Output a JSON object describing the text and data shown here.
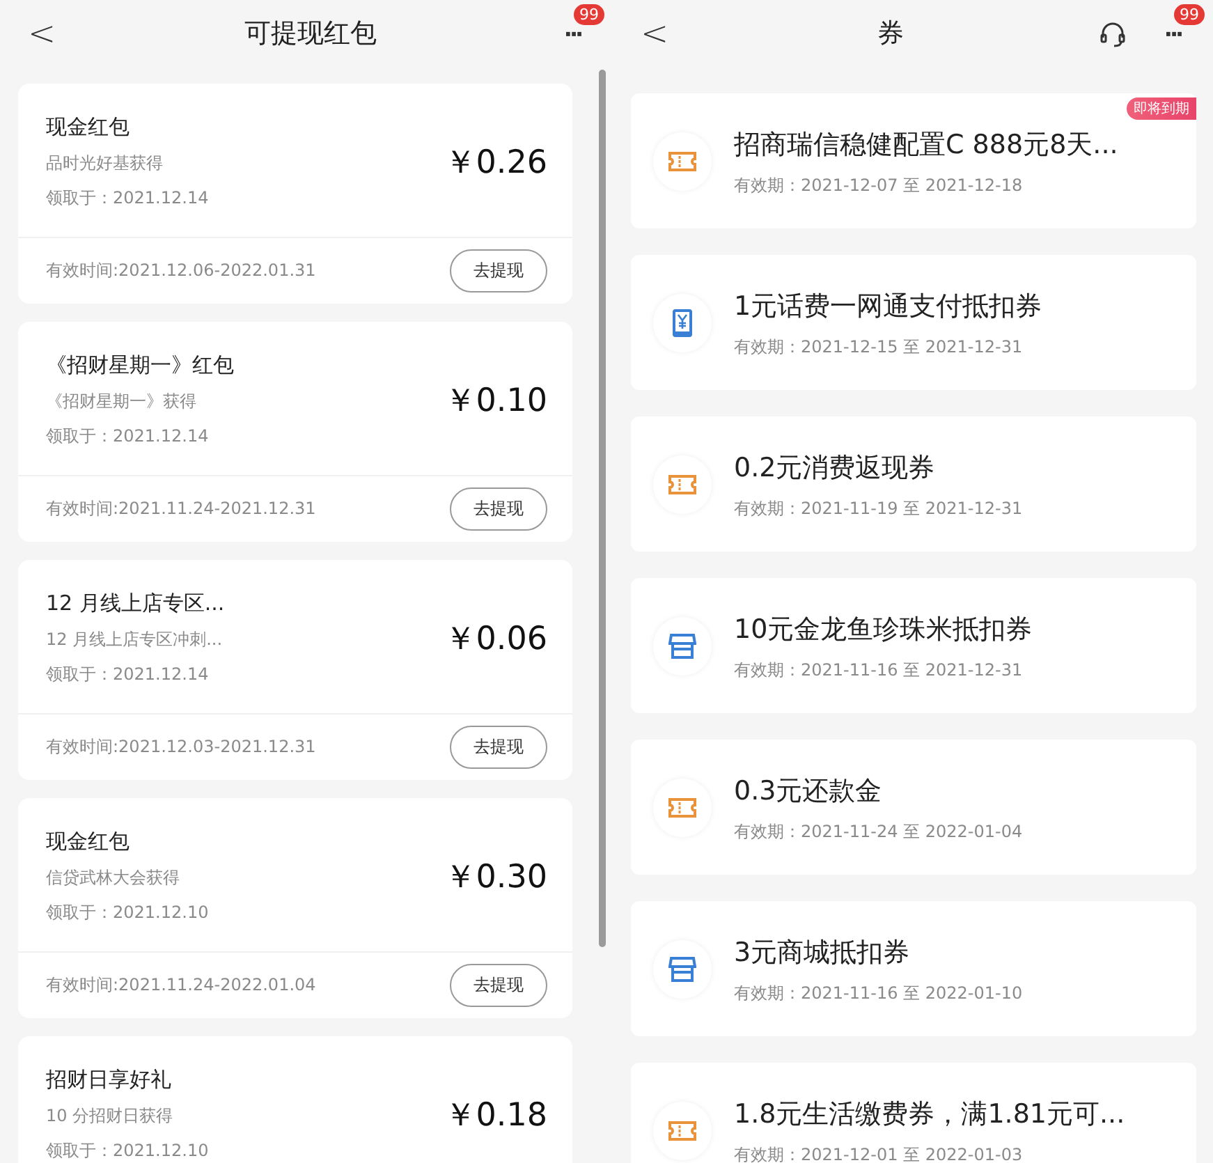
{
  "left_screen": {
    "back": "<",
    "title": "可提现红包",
    "more": "···",
    "badge": "99",
    "packets": [
      {
        "name": "现金红包",
        "source": "品时光好基获得",
        "received": "领取于：2021.12.14",
        "amount": "￥0.26",
        "validity": "有效时间:2021.12.06-2022.01.31",
        "action": "去提现"
      },
      {
        "name": "《招财星期一》红包",
        "source": "《招财星期一》获得",
        "received": "领取于：2021.12.14",
        "amount": "￥0.10",
        "validity": "有效时间:2021.11.24-2021.12.31",
        "action": "去提现"
      },
      {
        "name": "12 月线上店专区...",
        "source": "12 月线上店专区冲刺...",
        "received": "领取于：2021.12.14",
        "amount": "￥0.06",
        "validity": "有效时间:2021.12.03-2021.12.31",
        "action": "去提现"
      },
      {
        "name": "现金红包",
        "source": "信贷武林大会获得",
        "received": "领取于：2021.12.10",
        "amount": "￥0.30",
        "validity": "有效时间:2021.11.24-2022.01.04",
        "action": "去提现"
      },
      {
        "name": "招财日享好礼",
        "source": "10 分招财日获得",
        "received": "领取于：2021.12.10",
        "amount": "￥0.18"
      }
    ]
  },
  "right_screen": {
    "back": "<",
    "title": "券",
    "more": "···",
    "badge": "99",
    "coupons": [
      {
        "kind": "ticket",
        "name": "招商瑞信稳健配置C 888元8天...",
        "validity": "有效期：2021-12-07 至 2021-12-18",
        "tag": "即将到期"
      },
      {
        "kind": "phone",
        "name": "1元话费一网通支付抵扣券",
        "validity": "有效期：2021-12-15 至 2021-12-31"
      },
      {
        "kind": "ticket",
        "name": "0.2元消费返现券",
        "validity": "有效期：2021-11-19 至 2021-12-31"
      },
      {
        "kind": "store",
        "name": "10元金龙鱼珍珠米抵扣券",
        "validity": "有效期：2021-11-16 至 2021-12-31"
      },
      {
        "kind": "ticket",
        "name": "0.3元还款金",
        "validity": "有效期：2021-11-24 至 2022-01-04"
      },
      {
        "kind": "store",
        "name": "3元商城抵扣券",
        "validity": "有效期：2021-11-16 至 2022-01-10"
      },
      {
        "kind": "ticket",
        "name": "1.8元生活缴费券，满1.81元可...",
        "validity": "有效期：2021-12-01 至 2022-01-03"
      }
    ]
  }
}
